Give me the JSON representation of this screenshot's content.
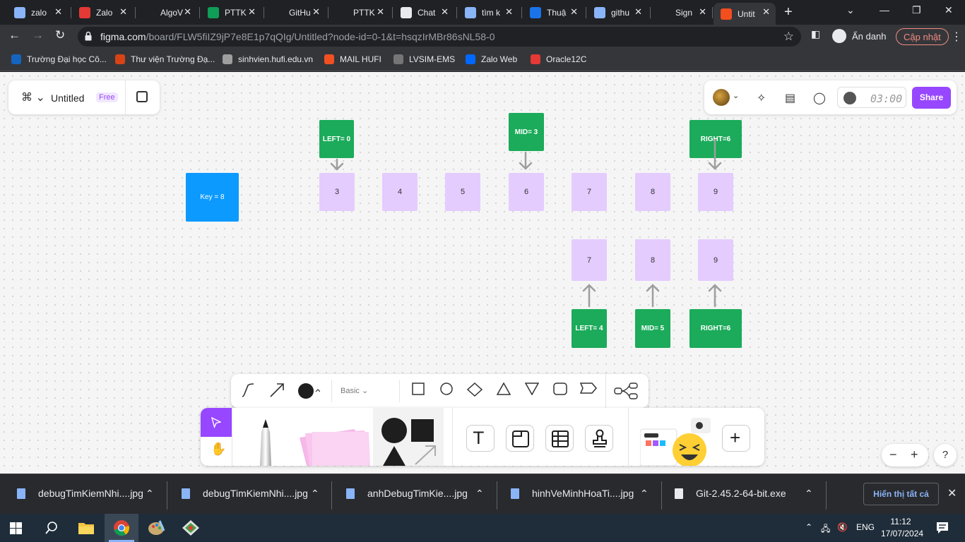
{
  "browser": {
    "tabs": [
      {
        "label": "zalo",
        "icon": "search-icon",
        "color": "#8ab4f8"
      },
      {
        "label": "Zalo",
        "icon": "zalo-icon",
        "color": "#e53935"
      },
      {
        "label": "AlgoV",
        "icon": "algovis-icon",
        "color": "#202124"
      },
      {
        "label": "PTTK",
        "icon": "sheets-icon",
        "color": "#0f9d58"
      },
      {
        "label": "GitHu",
        "icon": "github-icon",
        "color": "#202124"
      },
      {
        "label": "PTTK",
        "icon": "github-icon",
        "color": "#202124"
      },
      {
        "label": "Chat",
        "icon": "chatgpt-icon",
        "color": "#e8eaed"
      },
      {
        "label": "tìm k",
        "icon": "search-icon",
        "color": "#8ab4f8"
      },
      {
        "label": "Thuậ",
        "icon": "thuat-icon",
        "color": "#1a73e8"
      },
      {
        "label": "githu",
        "icon": "search-icon",
        "color": "#8ab4f8"
      },
      {
        "label": "Sign",
        "icon": "github-icon",
        "color": "#202124"
      },
      {
        "label": "Untit",
        "icon": "figma-icon",
        "color": "#f24e1e"
      }
    ],
    "url_host": "figma.com",
    "url_path": "/board/FLW5fiIZ9jP7e8E1p7qQIg/Untitled?node-id=0-1&t=hsqzIrMBr86sNL58-0",
    "profile_label": "Ẩn danh",
    "update_label": "Cập nhật",
    "bookmarks": [
      {
        "label": "Trường Đại học Cô...",
        "color": "#1565c0"
      },
      {
        "label": "Thư viện Trường Đạ...",
        "color": "#d84315"
      },
      {
        "label": "sinhvien.hufi.edu.vn",
        "color": "#9e9e9e"
      },
      {
        "label": "MAIL HUFI",
        "color": "#f25022"
      },
      {
        "label": "LVSIM-EMS",
        "color": "#757575"
      },
      {
        "label": "Zalo Web",
        "color": "#0068ff"
      },
      {
        "label": "Oracle12C",
        "color": "#e53935"
      }
    ]
  },
  "figma": {
    "file_title": "Untitled",
    "plan_badge": "Free",
    "timer": "03:00",
    "share_label": "Share",
    "shape_style_label": "Basic",
    "accent": "#9747ff",
    "board": {
      "key_box": "Key = 8",
      "top_row": [
        "3",
        "4",
        "5",
        "6",
        "7",
        "8",
        "9"
      ],
      "top_pointers": {
        "left": "LEFT= 0",
        "mid": "MID= 3",
        "right": "RIGHT=6"
      },
      "bottom_row": [
        "7",
        "8",
        "9"
      ],
      "bottom_pointers": {
        "left": "LEFT= 4",
        "mid": "MID= 5",
        "right": "RIGHT=6"
      }
    }
  },
  "downloads": {
    "items": [
      "debugTimKiemNhi....jpg",
      "debugTimKiemNhi....jpg",
      "anhDebugTimKie....jpg",
      "hinhVeMinhHoaTi....jpg",
      "Git-2.45.2-64-bit.exe"
    ],
    "show_all_label": "Hiển thị tất cả"
  },
  "taskbar": {
    "language": "ENG",
    "time": "11:12",
    "date": "17/07/2024"
  }
}
